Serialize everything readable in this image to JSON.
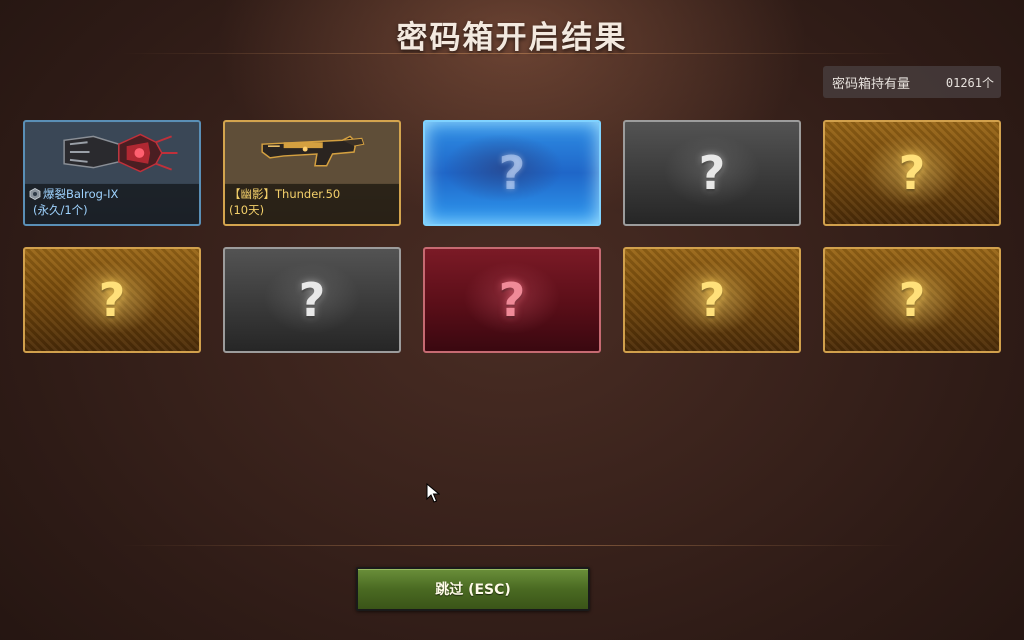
{
  "header": {
    "title": "密码箱开启结果"
  },
  "stock": {
    "label": "密码箱持有量",
    "value": "01261个"
  },
  "rewards": {
    "item1": {
      "name": "爆裂Balrog-IX",
      "duration": "(永久/1个)"
    },
    "item2": {
      "name": "【幽影】Thunder.50",
      "duration": "(10天)"
    }
  },
  "unopened_symbol": "?",
  "footer": {
    "skip_label": "跳过 (ESC)"
  },
  "colors": {
    "gold_frame": "#d1a04c",
    "grey_frame": "#9c9c9c",
    "red_frame": "#c66a72",
    "blue_frame": "#7fd2ff",
    "skip_button": "#4a6a22"
  }
}
